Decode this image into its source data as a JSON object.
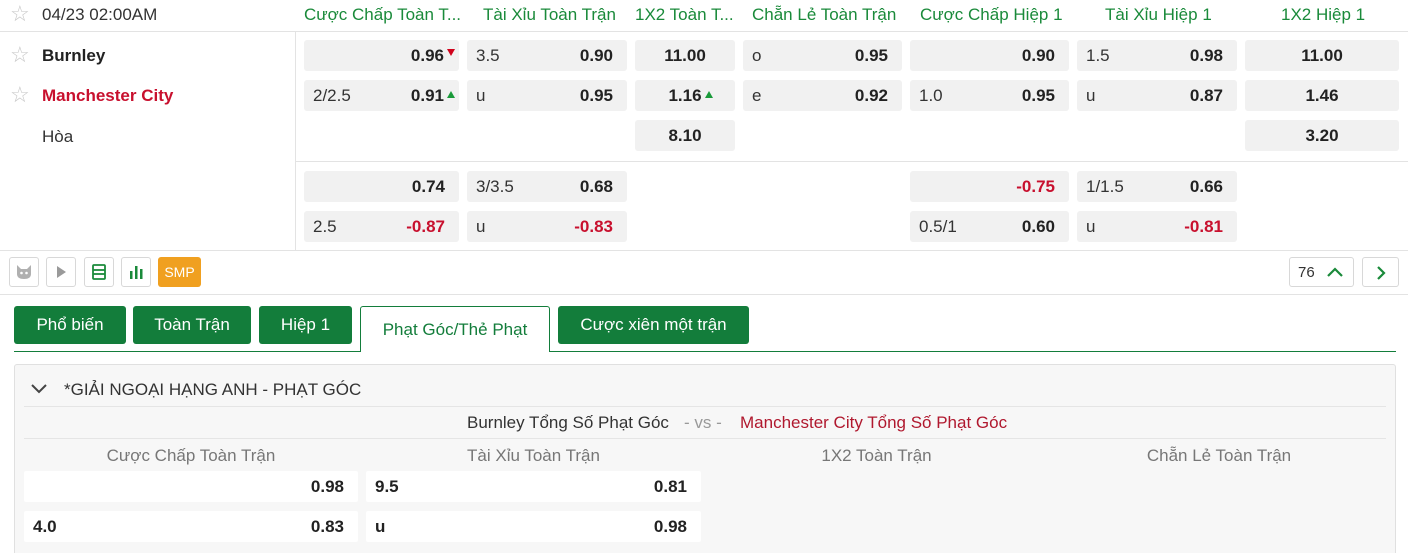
{
  "match": {
    "datetime": "04/23 02:00AM",
    "home": "Burnley",
    "away": "Manchester City",
    "draw": "Hòa"
  },
  "headers": [
    "Cược Chấp Toàn T...",
    "Tài Xỉu Toàn Trận",
    "1X2 Toàn T...",
    "Chẵn Lẻ Toàn Trận",
    "Cược Chấp Hiệp 1",
    "Tài Xỉu Hiệp 1",
    "1X2 Hiệp 1"
  ],
  "odds": {
    "ah_ft": {
      "r1_odd": "0.96",
      "r2_line": "2/2.5",
      "r2_odd": "0.91",
      "r3_odd": "0.74",
      "r4_line": "2.5",
      "r4_odd": "-0.87"
    },
    "ou_ft": {
      "r1_line": "3.5",
      "r1_odd": "0.90",
      "r2_line": "u",
      "r2_odd": "0.95",
      "r3_line": "3/3.5",
      "r3_odd": "0.68",
      "r4_line": "u",
      "r4_odd": "-0.83"
    },
    "x12_ft": {
      "home": "11.00",
      "away": "1.16",
      "draw": "8.10"
    },
    "oe_ft": {
      "r1_line": "o",
      "r1_odd": "0.95",
      "r2_line": "e",
      "r2_odd": "0.92"
    },
    "ah_h1": {
      "r1_odd": "0.90",
      "r2_line": "1.0",
      "r2_odd": "0.95",
      "r3_odd": "-0.75",
      "r4_line": "0.5/1",
      "r4_odd": "0.60"
    },
    "ou_h1": {
      "r1_line": "1.5",
      "r1_odd": "0.98",
      "r2_line": "u",
      "r2_odd": "0.87",
      "r3_line": "1/1.5",
      "r3_odd": "0.66",
      "r4_line": "u",
      "r4_odd": "-0.81"
    },
    "x12_h1": {
      "home": "11.00",
      "away": "1.46",
      "draw": "3.20"
    }
  },
  "toolbar": {
    "smp_label": "SMP",
    "more_count": "76"
  },
  "tabs": [
    "Phổ biến",
    "Toàn Trận",
    "Hiệp 1",
    "Phạt Góc/Thẻ Phạt",
    "Cược xiên một trận"
  ],
  "corner": {
    "league": "*GIẢI NGOẠI HẠNG ANH - PHẠT GÓC",
    "home_team": "Burnley Tổng Số Phạt Góc",
    "vs": "- vs -",
    "away_team": "Manchester City Tổng Số Phạt Góc",
    "headers": [
      "Cược Chấp Toàn Trận",
      "Tài Xỉu Toàn Trận",
      "1X2 Toàn Trận",
      "Chẵn Lẻ Toàn Trận"
    ],
    "ah": {
      "r1_odd": "0.98",
      "r2_line": "4.0",
      "r2_odd": "0.83"
    },
    "ou": {
      "r1_line": "9.5",
      "r1_odd": "0.81",
      "r2_line": "u",
      "r2_odd": "0.98"
    }
  },
  "colors": {
    "green": "#137d3b",
    "header_green": "#1a8a3a",
    "red": "#c8102e",
    "orange": "#f0a020"
  }
}
